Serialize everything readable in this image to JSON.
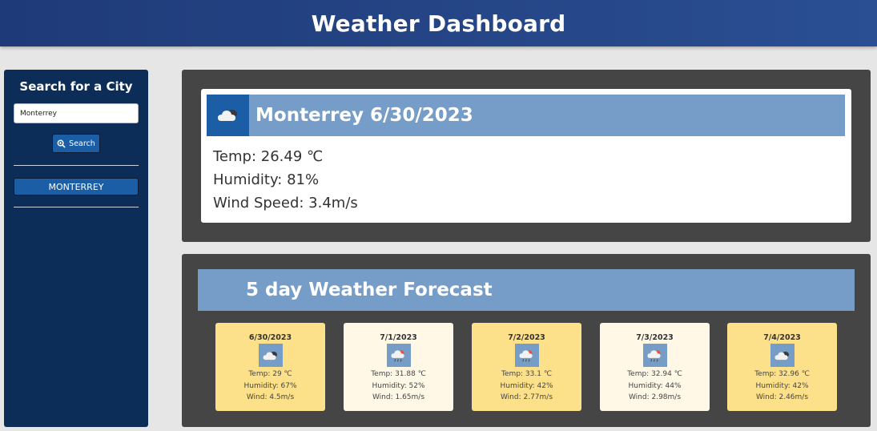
{
  "header": {
    "title": "Weather Dashboard"
  },
  "sidebar": {
    "heading": "Search for a City",
    "search_value": "Monterrey",
    "search_button_label": "Search",
    "history": [
      "MONTERREY"
    ]
  },
  "current": {
    "title": "Monterrey 6/30/2023",
    "icon": "cloud-icon",
    "temp": "Temp: 26.49 ℃",
    "humidity": "Humidity: 81%",
    "wind": "Wind Speed: 3.4m/s"
  },
  "forecast": {
    "heading": "5 day Weather Forecast",
    "days": [
      {
        "date": "6/30/2023",
        "icon": "cloud-icon",
        "temp": "Temp: 29 ℃",
        "humidity": "Humidity: 67%",
        "wind": "Wind: 4.5m/s"
      },
      {
        "date": "7/1/2023",
        "icon": "rain-icon",
        "temp": "Temp: 31.88 ℃",
        "humidity": "Humidity: 52%",
        "wind": "Wind: 1.65m/s"
      },
      {
        "date": "7/2/2023",
        "icon": "rain-icon",
        "temp": "Temp: 33.1 ℃",
        "humidity": "Humidity: 42%",
        "wind": "Wind: 2.77m/s"
      },
      {
        "date": "7/3/2023",
        "icon": "rain-icon",
        "temp": "Temp: 32.94 ℃",
        "humidity": "Humidity: 44%",
        "wind": "Wind: 2.98m/s"
      },
      {
        "date": "7/4/2023",
        "icon": "cloud-icon",
        "temp": "Temp: 32.96 ℃",
        "humidity": "Humidity: 42%",
        "wind": "Wind: 2.46m/s"
      }
    ]
  },
  "colors": {
    "header": "#1f3a78",
    "sidebar": "#0c2d57",
    "button": "#1b5ea6",
    "panel": "#454545",
    "banner": "#769dc8",
    "card_gold": "#fde08a",
    "card_cream": "#fff8e6"
  }
}
